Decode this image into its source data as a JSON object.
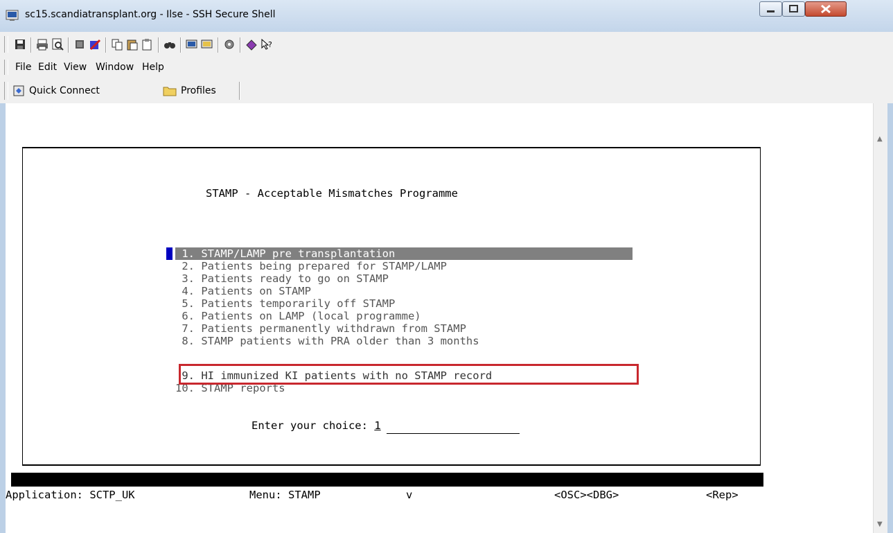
{
  "window": {
    "title": "sc15.scandiatransplant.org - Ilse - SSH Secure Shell"
  },
  "toolbar": {
    "icons": [
      "save-icon",
      "print-icon",
      "print-preview-icon",
      "disconnect-icon",
      "disconnect-all-icon",
      "copy-icon",
      "paste-icon",
      "paste-special-icon",
      "find-icon",
      "new-terminal-icon",
      "new-file-transfer-icon",
      "settings-icon",
      "help-icon",
      "context-help-icon"
    ]
  },
  "menubar": {
    "file": "File",
    "edit": "Edit",
    "view": "View",
    "window": "Window",
    "help": "Help"
  },
  "connbar": {
    "quick_connect": "Quick Connect",
    "profiles": "Profiles"
  },
  "terminal": {
    "heading": "STAMP - Acceptable Mismatches Programme",
    "menu_items": [
      " 1. STAMP/LAMP pre transplantation                  ",
      " 2. Patients being prepared for STAMP/LAMP",
      " 3. Patients ready to go on STAMP",
      " 4. Patients on STAMP",
      " 5. Patients temporarily off STAMP",
      " 6. Patients on LAMP (local programme)",
      " 7. Patients permanently withdrawn from STAMP",
      " 8. STAMP patients with PRA older than 3 months",
      " 9. HI immunized KI patients with no STAMP record",
      "10. STAMP reports"
    ],
    "prompt_label": "Enter your choice: ",
    "prompt_value": "1",
    "status": {
      "application": "Application: SCTP_UK",
      "menu": "Menu: STAMP",
      "mode": "v",
      "flags": "<OSC><DBG>",
      "rep": "<Rep>"
    }
  },
  "colors": {
    "selection_bg": "#808080",
    "cursor": "#0000c0",
    "annotation_box": "#c8282e"
  }
}
